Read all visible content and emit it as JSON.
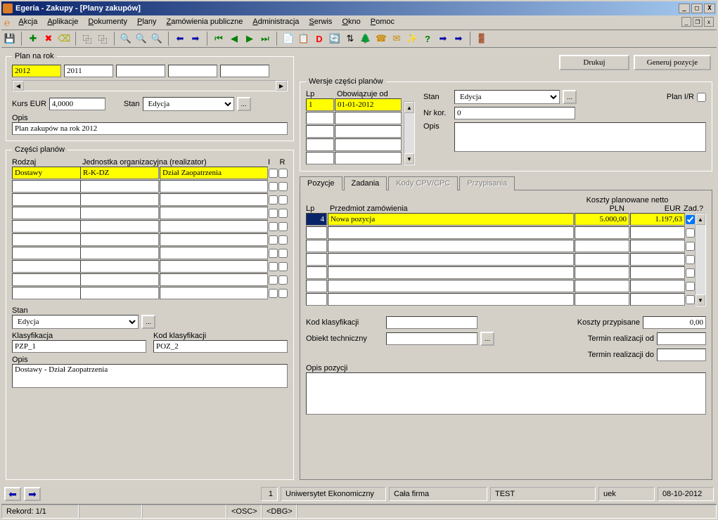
{
  "window": {
    "title": "Egeria - Zakupy - [Plany zakupów]"
  },
  "menu": {
    "items": [
      "Akcja",
      "Aplikacje",
      "Dokumenty",
      "Plany",
      "Zamówienia publiczne",
      "Administracja",
      "Serwis",
      "Okno",
      "Pomoc"
    ]
  },
  "buttons": {
    "drukuj": "Drukuj",
    "generuj": "Generuj pozycje"
  },
  "plan_na_rok": {
    "legend": "Plan na rok",
    "years": [
      "2012",
      "2011",
      "",
      "",
      ""
    ],
    "kurs_label": "Kurs EUR",
    "kurs_value": "4,0000",
    "stan_label": "Stan",
    "stan_value": "Edycja",
    "opis_label": "Opis",
    "opis_value": "Plan zakupów na rok 2012"
  },
  "wersje": {
    "legend": "Wersje części planów",
    "lp_label": "Lp",
    "obowiazuje_label": "Obowiązuje od",
    "rows": [
      {
        "lp": "1",
        "od": "01-01-2012"
      },
      {
        "lp": "",
        "od": ""
      },
      {
        "lp": "",
        "od": ""
      },
      {
        "lp": "",
        "od": ""
      },
      {
        "lp": "",
        "od": ""
      }
    ],
    "stan_label": "Stan",
    "stan_value": "Edycja",
    "nrkor_label": "Nr kor.",
    "nrkor_value": "0",
    "opis_label": "Opis",
    "opis_value": "",
    "planir_label": "Plan I/R"
  },
  "czesci": {
    "legend": "Części planów",
    "rodzaj_label": "Rodzaj",
    "jedn_label": "Jednostka organizacyjna (realizator)",
    "i_label": "I",
    "r_label": "R",
    "rows": [
      {
        "rodzaj": "Dostawy",
        "kod": "R-K-DZ",
        "jedn": "Dział Zaopatrzenia"
      },
      {
        "rodzaj": "",
        "kod": "",
        "jedn": ""
      },
      {
        "rodzaj": "",
        "kod": "",
        "jedn": ""
      },
      {
        "rodzaj": "",
        "kod": "",
        "jedn": ""
      },
      {
        "rodzaj": "",
        "kod": "",
        "jedn": ""
      },
      {
        "rodzaj": "",
        "kod": "",
        "jedn": ""
      },
      {
        "rodzaj": "",
        "kod": "",
        "jedn": ""
      },
      {
        "rodzaj": "",
        "kod": "",
        "jedn": ""
      },
      {
        "rodzaj": "",
        "kod": "",
        "jedn": ""
      },
      {
        "rodzaj": "",
        "kod": "",
        "jedn": ""
      }
    ],
    "stan_label": "Stan",
    "stan_value": "Edycja",
    "klas_label": "Klasyfikacja",
    "klas_value": "PZP_1",
    "kodklas_label": "Kod klasyfikacji",
    "kodklas_value": "POZ_2",
    "opis_label": "Opis",
    "opis_value": "Dostawy - Dział Zaopatrzenia"
  },
  "tabs": {
    "pozycje": "Pozycje",
    "zadania": "Zadania",
    "kody": "Kody CPV/CPC",
    "przyp": "Przypisania"
  },
  "pozycje": {
    "lp_label": "Lp",
    "przedmiot_label": "Przedmiot zamówienia",
    "koszty_label": "Koszty planowane netto",
    "pln_label": "PLN",
    "eur_label": "EUR",
    "zad_label": "Zad.?",
    "rows": [
      {
        "lp": "4",
        "przedmiot": "Nowa pozycja",
        "pln": "5.000,00",
        "eur": "1.197,63",
        "zad": true
      },
      {
        "lp": "",
        "przedmiot": "",
        "pln": "",
        "eur": "",
        "zad": false
      },
      {
        "lp": "",
        "przedmiot": "",
        "pln": "",
        "eur": "",
        "zad": false
      },
      {
        "lp": "",
        "przedmiot": "",
        "pln": "",
        "eur": "",
        "zad": false
      },
      {
        "lp": "",
        "przedmiot": "",
        "pln": "",
        "eur": "",
        "zad": false
      },
      {
        "lp": "",
        "przedmiot": "",
        "pln": "",
        "eur": "",
        "zad": false
      },
      {
        "lp": "",
        "przedmiot": "",
        "pln": "",
        "eur": "",
        "zad": false
      }
    ],
    "kodklas_label": "Kod klasyfikacji",
    "kodklas_value": "",
    "obiekt_label": "Obiekt techniczny",
    "obiekt_value": "",
    "kosztyprzyp_label": "Koszty przypisane",
    "kosztyprzyp_value": "0,00",
    "terminod_label": "Termin realizacji od",
    "terminod_value": "",
    "termindo_label": "Termin realizacji do",
    "termindo_value": "",
    "opispoz_label": "Opis pozycji",
    "opispoz_value": ""
  },
  "status": {
    "record": "Rekord: 1/1",
    "osc": "<OSC>",
    "dbg": "<DBG>",
    "cells": [
      "1",
      "Uniwersytet Ekonomiczny",
      "Cała firma",
      "TEST",
      "uek",
      "08-10-2012"
    ]
  }
}
